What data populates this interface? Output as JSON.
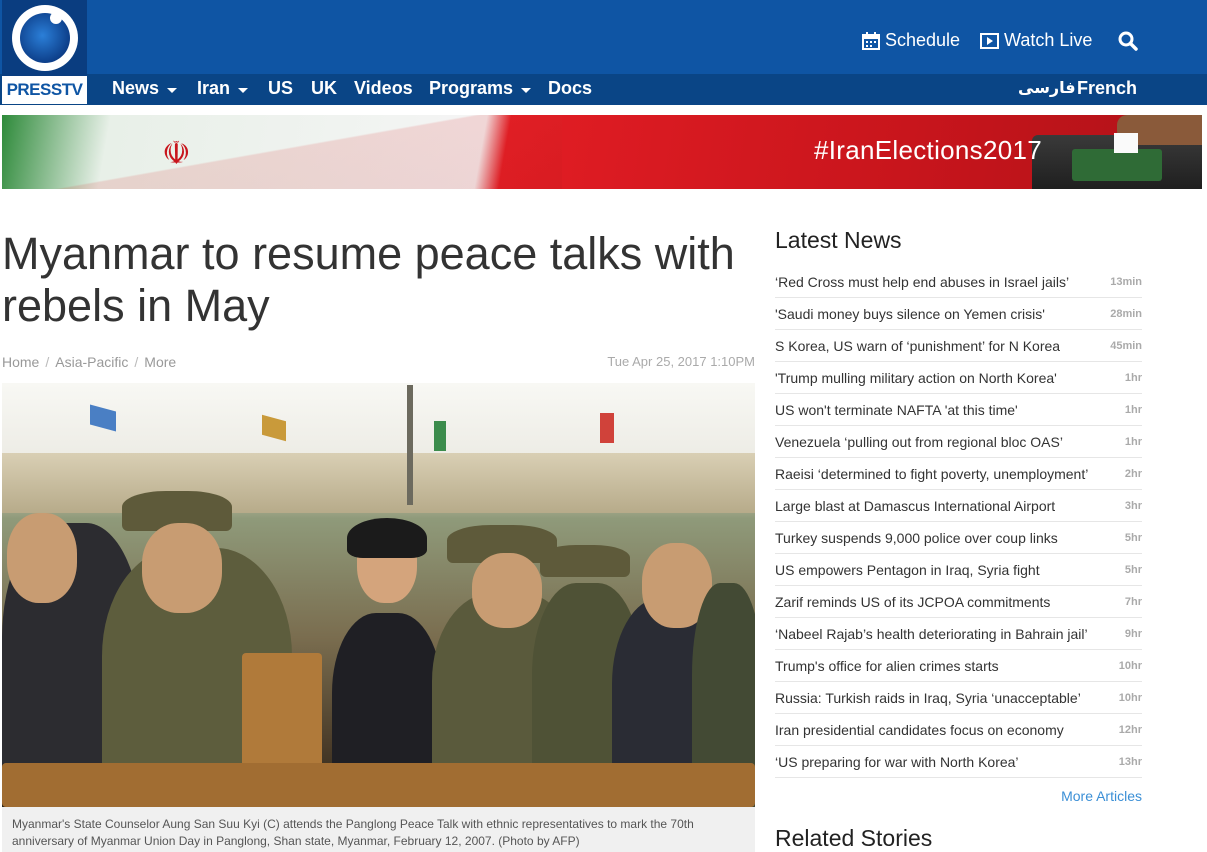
{
  "brand": {
    "logo_text": "PRESSTV"
  },
  "header": {
    "schedule_label": "Schedule",
    "watch_live_label": "Watch Live"
  },
  "nav": {
    "items": [
      {
        "label": "News",
        "has_dropdown": true
      },
      {
        "label": "Iran",
        "has_dropdown": true
      },
      {
        "label": "US",
        "has_dropdown": false
      },
      {
        "label": "UK",
        "has_dropdown": false
      },
      {
        "label": "Videos",
        "has_dropdown": false
      },
      {
        "label": "Programs",
        "has_dropdown": true
      },
      {
        "label": "Docs",
        "has_dropdown": false
      }
    ],
    "languages": [
      "فارسی",
      "French"
    ]
  },
  "banner": {
    "hashtag": "#IranElections2017"
  },
  "article": {
    "title": "Myanmar to resume peace talks with rebels in May",
    "breadcrumb": [
      "Home",
      "Asia-Pacific",
      "More"
    ],
    "date": "Tue Apr 25, 2017 1:10PM",
    "caption": "Myanmar's State Counselor Aung San Suu Kyi (C) attends the Panglong Peace Talk with ethnic representatives to mark the 70th anniversary of Myanmar Union Day in Panglong, Shan state, Myanmar, February 12, 2007. (Photo by AFP)"
  },
  "sidebar": {
    "latest_title": "Latest News",
    "items": [
      {
        "headline": "‘Red Cross must help end abuses in Israel jails’",
        "time": "13min"
      },
      {
        "headline": "'Saudi money buys silence on Yemen crisis'",
        "time": "28min"
      },
      {
        "headline": "S Korea, US warn of ‘punishment’ for N Korea",
        "time": "45min"
      },
      {
        "headline": "'Trump mulling military action on North Korea'",
        "time": "1hr"
      },
      {
        "headline": "US won't terminate NAFTA 'at this time'",
        "time": "1hr"
      },
      {
        "headline": "Venezuela ‘pulling out from regional bloc OAS’",
        "time": "1hr"
      },
      {
        "headline": "Raeisi ‘determined to fight poverty, unemployment’",
        "time": "2hr"
      },
      {
        "headline": "Large blast at Damascus International Airport",
        "time": "3hr"
      },
      {
        "headline": "Turkey suspends 9,000 police over coup links",
        "time": "5hr"
      },
      {
        "headline": "US empowers Pentagon in Iraq, Syria fight",
        "time": "5hr"
      },
      {
        "headline": "Zarif reminds US of its JCPOA commitments",
        "time": "7hr"
      },
      {
        "headline": "‘Nabeel Rajab’s health deteriorating in Bahrain jail’",
        "time": "9hr"
      },
      {
        "headline": "Trump's office for alien crimes starts",
        "time": "10hr"
      },
      {
        "headline": "Russia: Turkish raids in Iraq, Syria ‘unacceptable’",
        "time": "10hr"
      },
      {
        "headline": "Iran presidential candidates focus on economy",
        "time": "12hr"
      },
      {
        "headline": "‘US preparing for war with North Korea’",
        "time": "13hr"
      }
    ],
    "more_label": "More Articles",
    "related_title": "Related Stories"
  },
  "colors": {
    "header_blue": "#0f55a4",
    "nav_blue": "#0a4586",
    "link_blue": "#3b8fd6"
  }
}
